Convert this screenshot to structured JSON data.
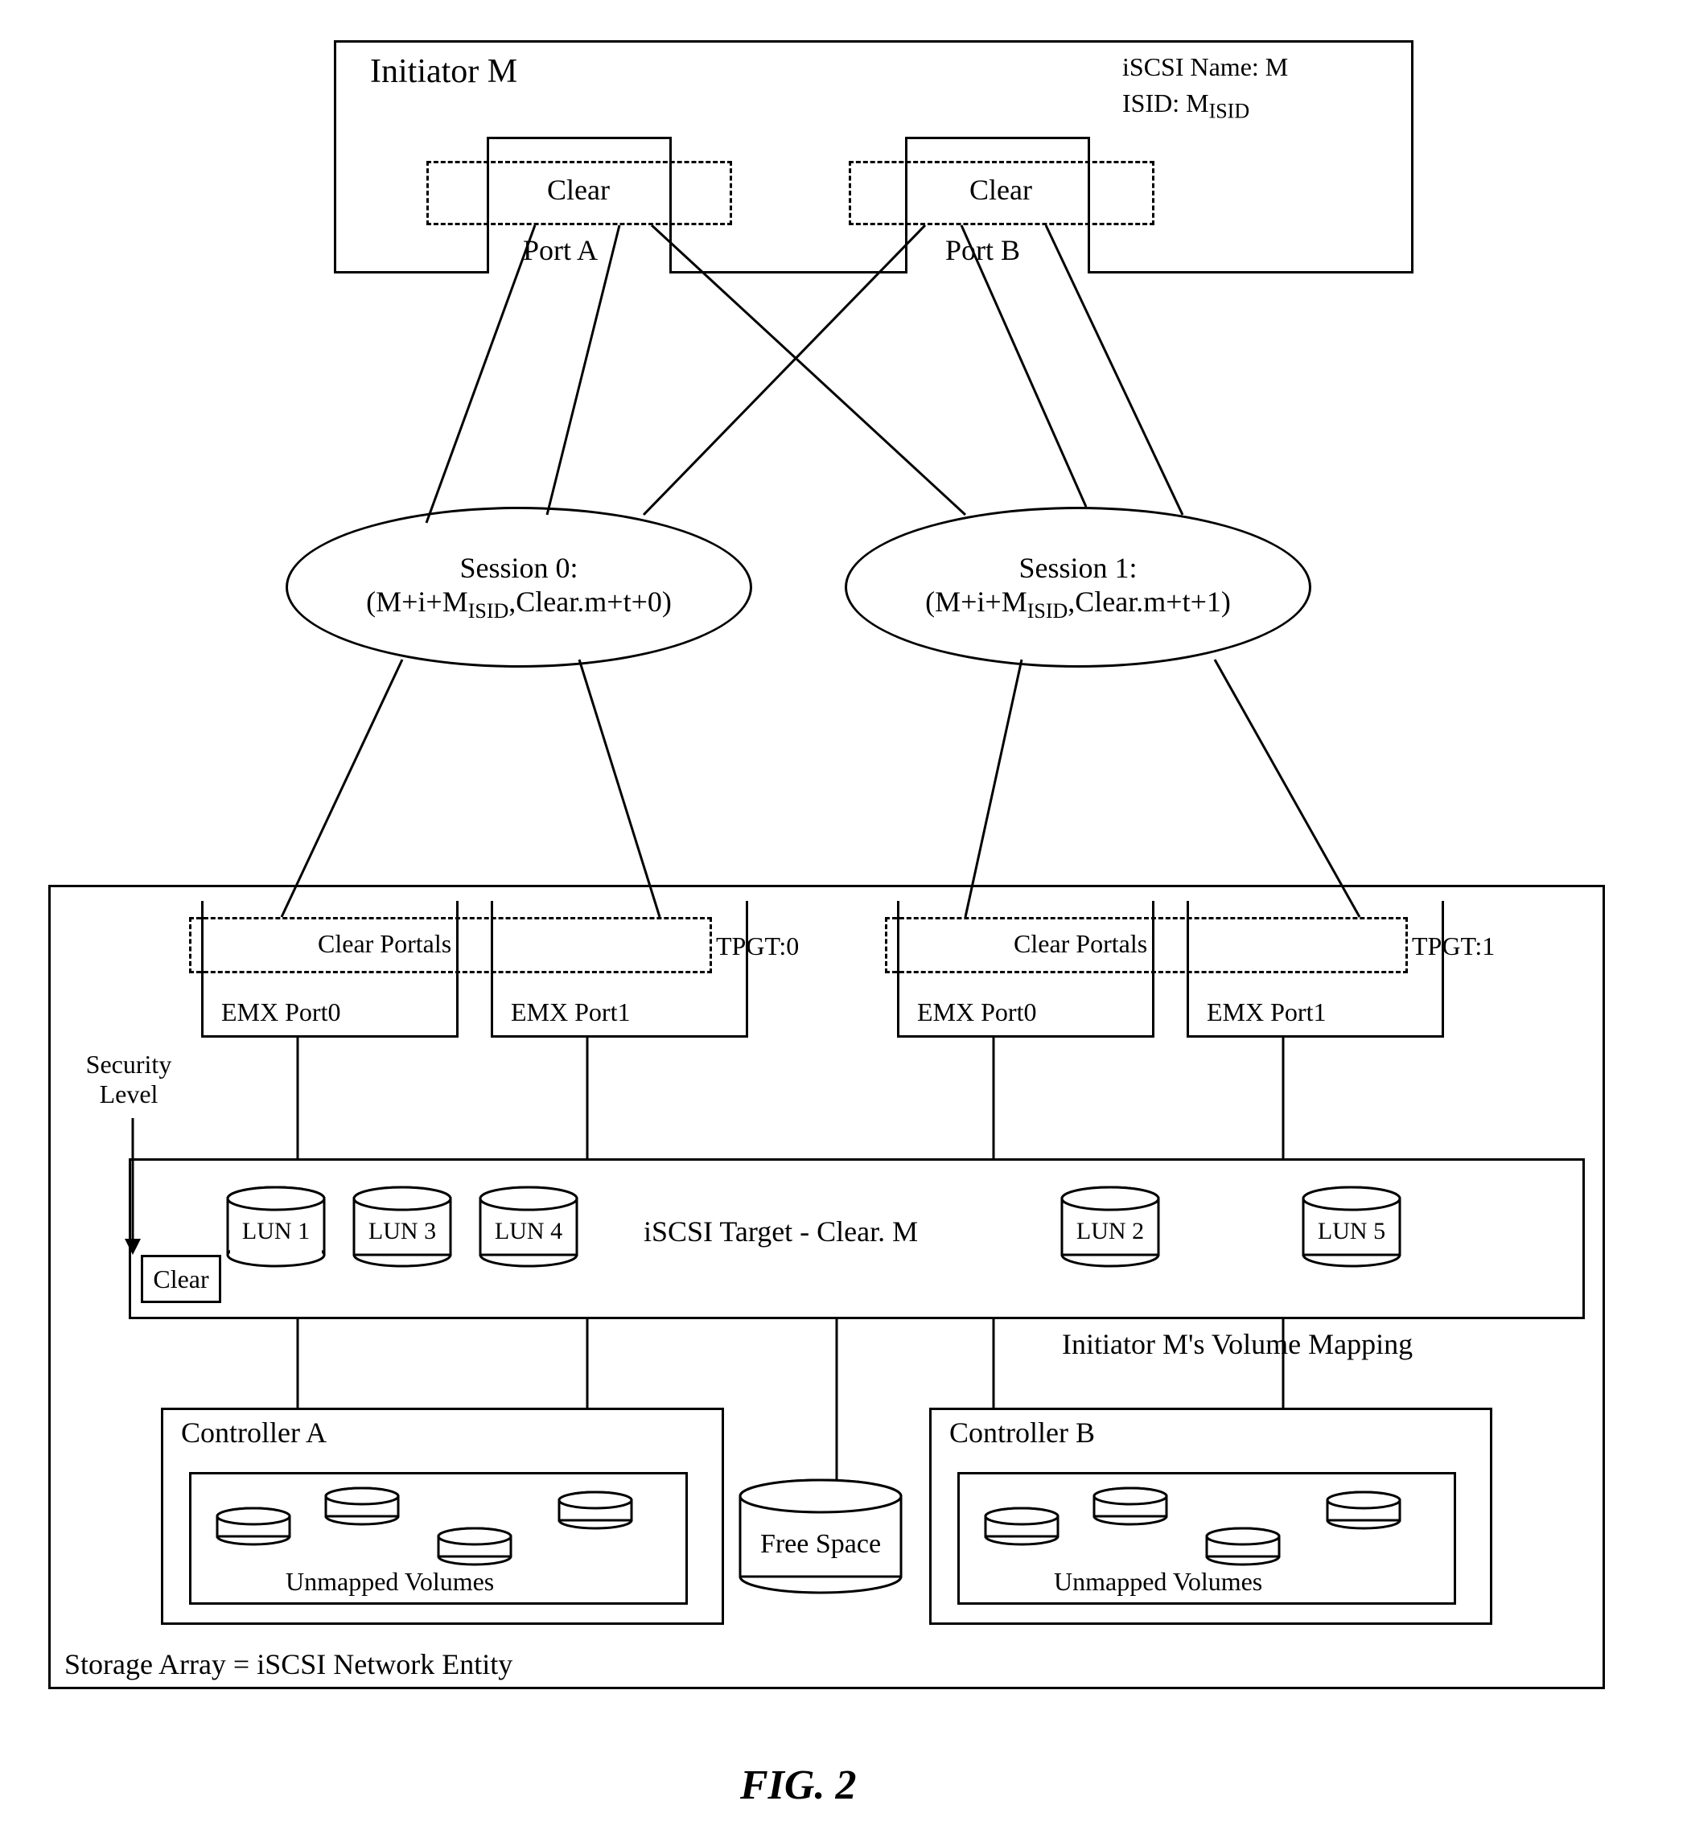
{
  "initiator": {
    "title": "Initiator M",
    "iscsi_name_label": "iSCSI Name: M",
    "isid_label": "ISID: M",
    "isid_sub": "ISID",
    "port_a": {
      "label": "Port A",
      "clear": "Clear"
    },
    "port_b": {
      "label": "Port B",
      "clear": "Clear"
    }
  },
  "sessions": {
    "session0": {
      "title": "Session 0:",
      "detail": "(M+i+M",
      "detail_sub": "ISID",
      "detail_end": ",Clear.m+t+0)"
    },
    "session1": {
      "title": "Session 1:",
      "detail": "(M+i+M",
      "detail_sub": "ISID",
      "detail_end": ",Clear.m+t+1)"
    }
  },
  "storage": {
    "title": "Storage Array = iSCSI Network Entity",
    "tpgt0": {
      "label": "TPGT:0",
      "portals": "Clear  Portals",
      "port0": "EMX Port0",
      "port1": "EMX Port1"
    },
    "tpgt1": {
      "label": "TPGT:1",
      "portals": "Clear  Portals",
      "port0": "EMX Port0",
      "port1": "EMX Port1"
    },
    "security_label": "Security Level",
    "target": {
      "clear_label": "Clear",
      "title": "iSCSI Target - Clear. M",
      "luns": [
        "LUN 1",
        "LUN 3",
        "LUN 4",
        "LUN 2",
        "LUN 5"
      ],
      "mapping_label": "Initiator M's Volume Mapping"
    },
    "controller_a": {
      "label": "Controller A",
      "unmapped": "Unmapped Volumes"
    },
    "controller_b": {
      "label": "Controller B",
      "unmapped": "Unmapped Volumes"
    },
    "free_space": "Free Space"
  },
  "figure_label": "FIG. 2"
}
